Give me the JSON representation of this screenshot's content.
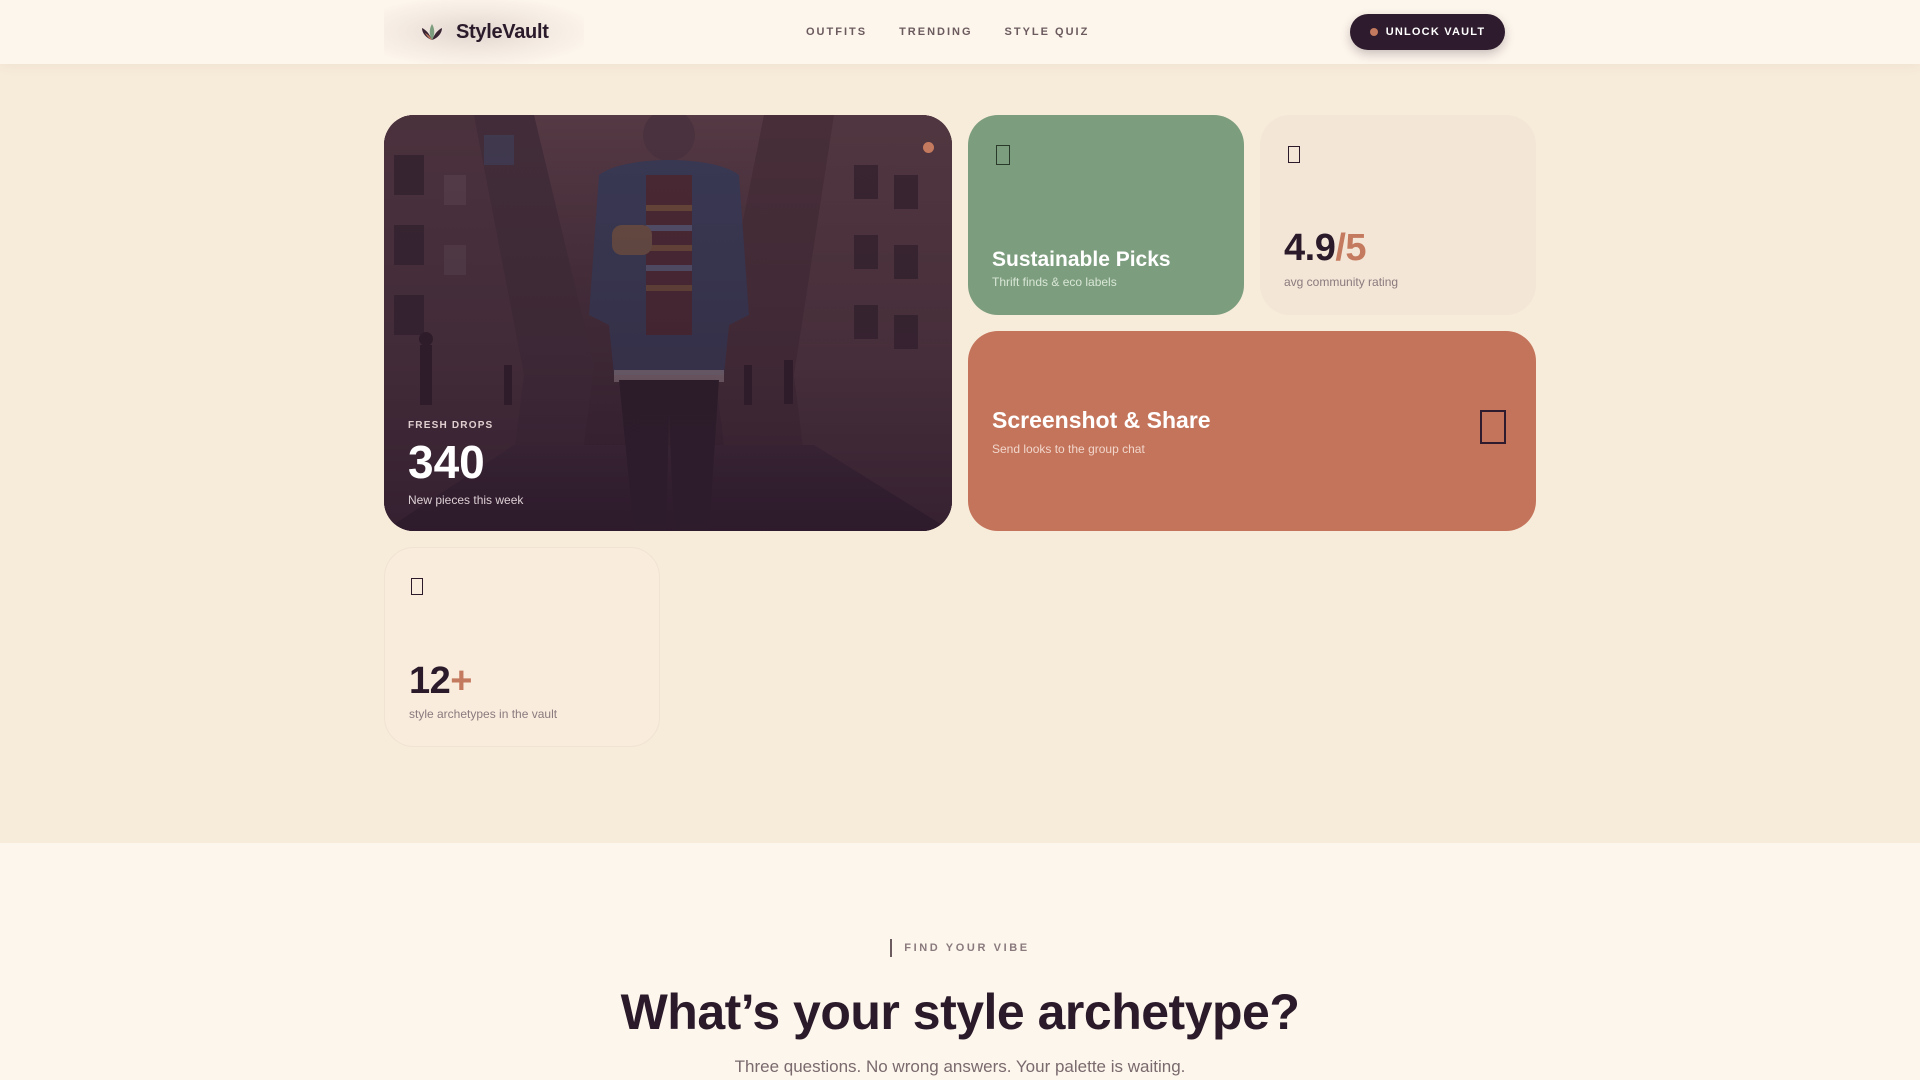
{
  "brand": {
    "name": "StyleVault",
    "logo_icon": "lotus-icon"
  },
  "nav": {
    "items": [
      {
        "label": "OUTFITS"
      },
      {
        "label": "TRENDING"
      },
      {
        "label": "STYLE QUIZ"
      }
    ]
  },
  "cta": {
    "label": "UNLOCK VAULT"
  },
  "bento": {
    "hero": {
      "eyebrow": "FRESH DROPS",
      "value": "340",
      "caption": "New pieces this week",
      "image": "street-fashion-photo"
    },
    "sustainable": {
      "title": "Sustainable Picks",
      "caption": "Thrift finds & eco labels",
      "icon": "leaf-icon"
    },
    "rating": {
      "value": "4.9",
      "suffix": "/5",
      "caption": "avg community rating",
      "icon": "star-icon"
    },
    "share": {
      "title": "Screenshot & Share",
      "caption": "Send looks to the group chat",
      "icon": "phone-icon"
    },
    "archetypes": {
      "value": "12",
      "suffix": "+",
      "caption": "style archetypes in the vault",
      "icon": "sparkle-icon"
    }
  },
  "quiz_section": {
    "kicker": "FIND YOUR VIBE",
    "headline": "What’s your style archetype?",
    "subline": "Three questions. No wrong answers. Your palette is waiting."
  },
  "colors": {
    "accent": "#c47a5e",
    "dark": "#2e1b2d",
    "sage": "#7d9e7e",
    "terracotta": "#c4745a",
    "cream": "#fdf6ec"
  }
}
